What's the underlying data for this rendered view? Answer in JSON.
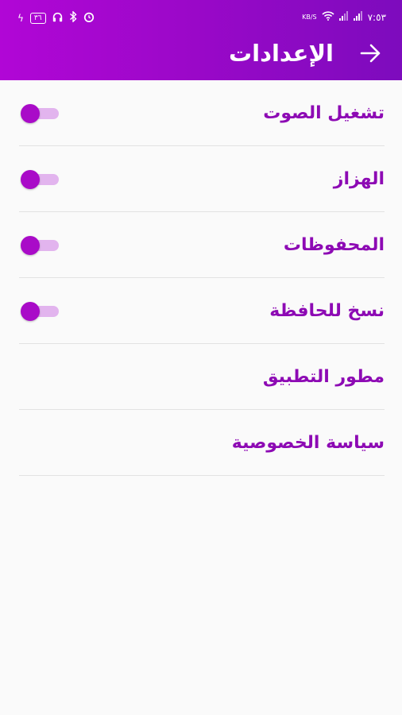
{
  "status_bar": {
    "time": "٧:٥٣",
    "battery": "٣٦",
    "network": "KB/S"
  },
  "toolbar": {
    "title": "الإعدادات"
  },
  "settings": {
    "items": [
      {
        "label": "تشغيل الصوت",
        "toggle": true
      },
      {
        "label": "الهزاز",
        "toggle": true
      },
      {
        "label": "المحفوظات",
        "toggle": true
      },
      {
        "label": "نسخ للحافظة",
        "toggle": true
      },
      {
        "label": "مطور التطبيق",
        "toggle": false
      },
      {
        "label": "سياسة الخصوصية",
        "toggle": false
      }
    ]
  },
  "colors": {
    "appbar_gradient_start": "#b106d6",
    "appbar_gradient_end": "#7d0bbd",
    "accent": "#a90bc8",
    "label_text": "#8d0ab4",
    "switch_track": "#e2b4ee",
    "background": "#fafafa"
  }
}
